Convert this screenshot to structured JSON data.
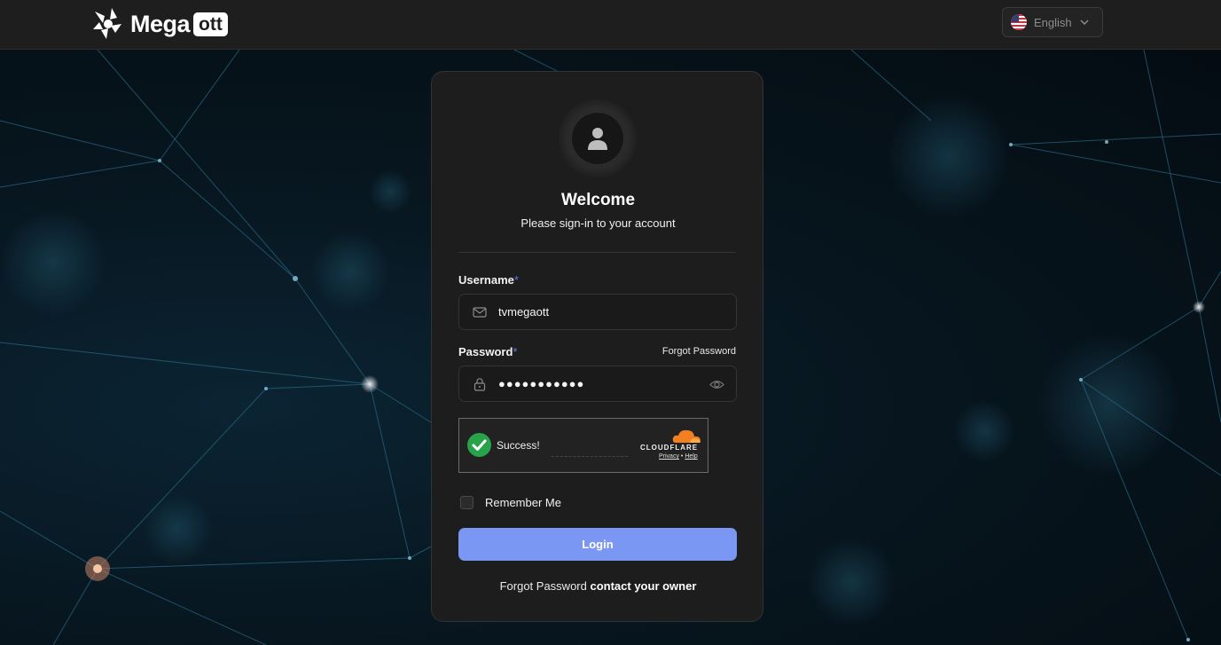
{
  "header": {
    "brand_name": "Mega",
    "brand_badge": "ott",
    "language": {
      "selected": "English",
      "flag_icon": "us-flag-icon",
      "chevron_icon": "chevron-down-icon"
    }
  },
  "login_card": {
    "title": "Welcome",
    "subtitle": "Please sign-in to your account",
    "username": {
      "label": "Username",
      "required_mark": "*",
      "value": "tvmegaott",
      "icon": "mail-icon"
    },
    "password": {
      "label": "Password",
      "required_mark": "*",
      "masked_value": "●●●●●●●●●●●",
      "icon": "lock-icon",
      "toggle_icon": "eye-icon",
      "forgot_link": "Forgot Password"
    },
    "captcha": {
      "status": "Success!",
      "provider": "CLOUDFLARE",
      "privacy_link": "Privacy",
      "separator": "•",
      "help_link": "Help"
    },
    "remember_me": {
      "label": "Remember Me",
      "checked": false
    },
    "login_button": "Login",
    "footer": {
      "prefix": "Forgot Password",
      "link": "contact your owner"
    }
  },
  "colors": {
    "accent": "#7b97f4",
    "required": "#5b7cf0",
    "success": "#29a34a",
    "cloudflare": "#f38020"
  }
}
